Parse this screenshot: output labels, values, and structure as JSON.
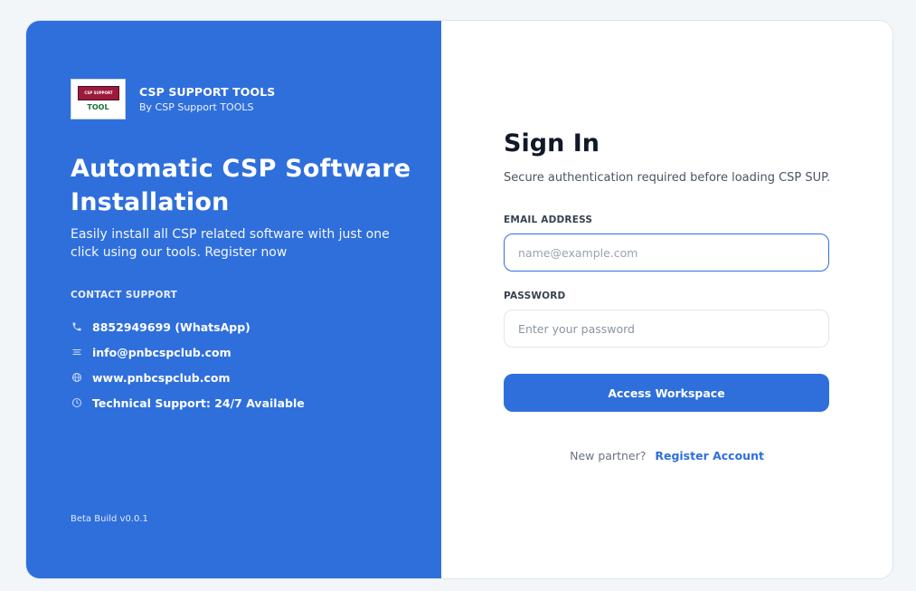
{
  "brand": {
    "logo_banner": "CSP SUPPORT",
    "logo_tool": "TOOL",
    "name": "CSP SUPPORT TOOLS",
    "subtitle": "By CSP Support TOOLS"
  },
  "hero": {
    "headline": "Automatic CSP Software Installation",
    "lead": "Easily install all  CSP related software with just one click using our tools. Register now"
  },
  "support": {
    "title": "CONTACT SUPPORT",
    "items": [
      {
        "icon": "phone-icon",
        "text": "8852949699 (WhatsApp)"
      },
      {
        "icon": "mail-icon",
        "text": "info@pnbcspclub.com"
      },
      {
        "icon": "globe-icon",
        "text": "www.pnbcspclub.com"
      },
      {
        "icon": "clock-icon",
        "text": "Technical Support: 24/7 Available"
      }
    ]
  },
  "version": "Beta Build v0.0.1",
  "signin": {
    "title": "Sign In",
    "subtitle": "Secure authentication required before loading CSP SUP...",
    "email_label": "EMAIL ADDRESS",
    "email_placeholder": "name@example.com",
    "email_value": "",
    "password_label": "PASSWORD",
    "password_placeholder": "Enter your password",
    "password_value": "",
    "submit_label": "Access Workspace",
    "register_question": "New partner?",
    "register_link": "Register Account"
  },
  "colors": {
    "primary": "#2f6fdc",
    "background": "#f3f6f9",
    "text_dark": "#111827"
  }
}
